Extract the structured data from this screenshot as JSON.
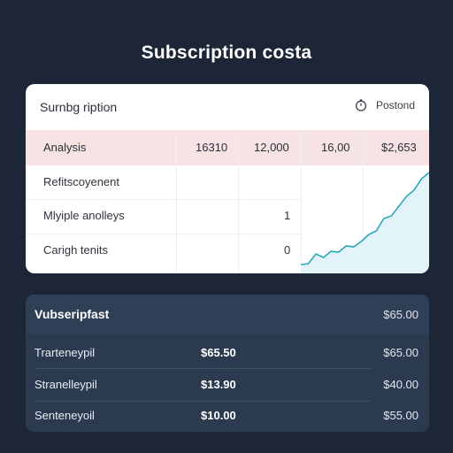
{
  "page": {
    "title": "Subscription costa"
  },
  "card": {
    "title": "Surnbg ription",
    "period_label": "Postond",
    "analysis": {
      "label": "Analysis",
      "values": [
        "16310",
        "12,000",
        "16,00",
        "$2,653"
      ]
    },
    "rows": [
      {
        "label": "Refitscoyenent",
        "value": ""
      },
      {
        "label": "Mlyiple anolleys",
        "value": "1"
      },
      {
        "label": "Carigh tenits",
        "value": "0"
      }
    ],
    "chart_data": {
      "type": "area",
      "values": [
        6,
        7,
        18,
        14,
        21,
        20,
        27,
        26,
        32,
        40,
        44,
        58,
        61,
        72,
        83,
        90,
        103,
        110
      ]
    },
    "colors": {
      "line": "#2aa7b8",
      "fill": "#e3f3fa",
      "accent_row": "#f7e3e4"
    }
  },
  "panel": {
    "title": "Vubseripfast",
    "total": "$65.00",
    "rows": [
      {
        "name": "Trarteneypil",
        "amount": "$65.50",
        "right": "$65.00"
      },
      {
        "name": "Stranelleypil",
        "amount": "$13.90",
        "right": "$40.00"
      },
      {
        "name": "Senteneyoil",
        "amount": "$10.00",
        "right": "$55.00"
      }
    ]
  }
}
